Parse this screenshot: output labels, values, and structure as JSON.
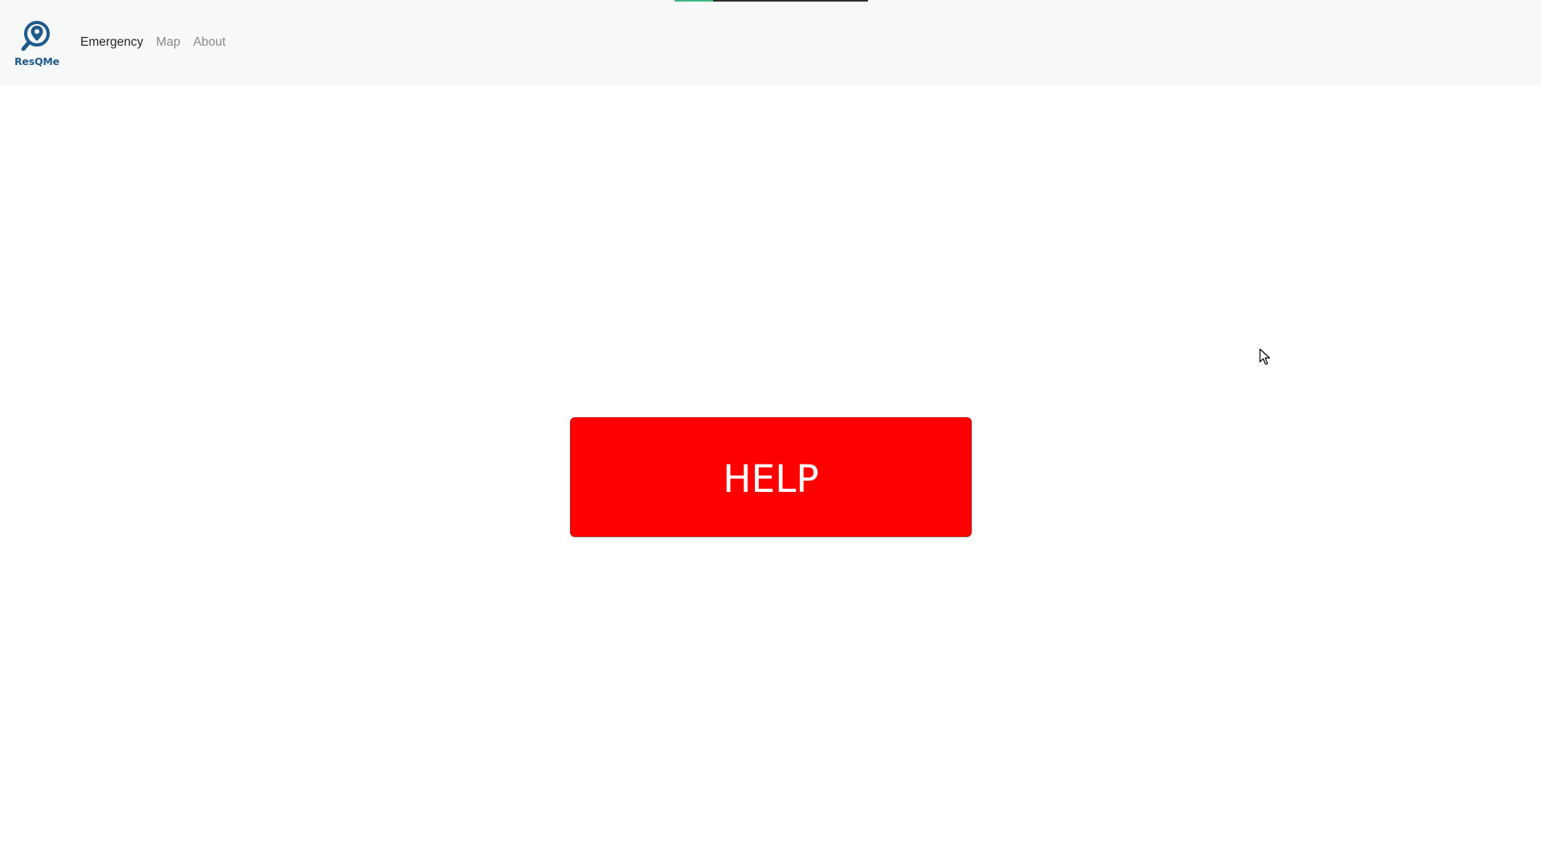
{
  "app": {
    "brand_name": "ResQMe",
    "accent_color": "#1f5a8b"
  },
  "navbar": {
    "items": [
      {
        "label": "Emergency",
        "active": true
      },
      {
        "label": "Map",
        "active": false
      },
      {
        "label": "About",
        "active": false
      }
    ]
  },
  "main": {
    "help_button_label": "HELP",
    "help_button_color": "#ff0000"
  },
  "icons": {
    "logo": "location-pin-magnifier-icon",
    "cursor": "mouse-pointer-icon"
  }
}
